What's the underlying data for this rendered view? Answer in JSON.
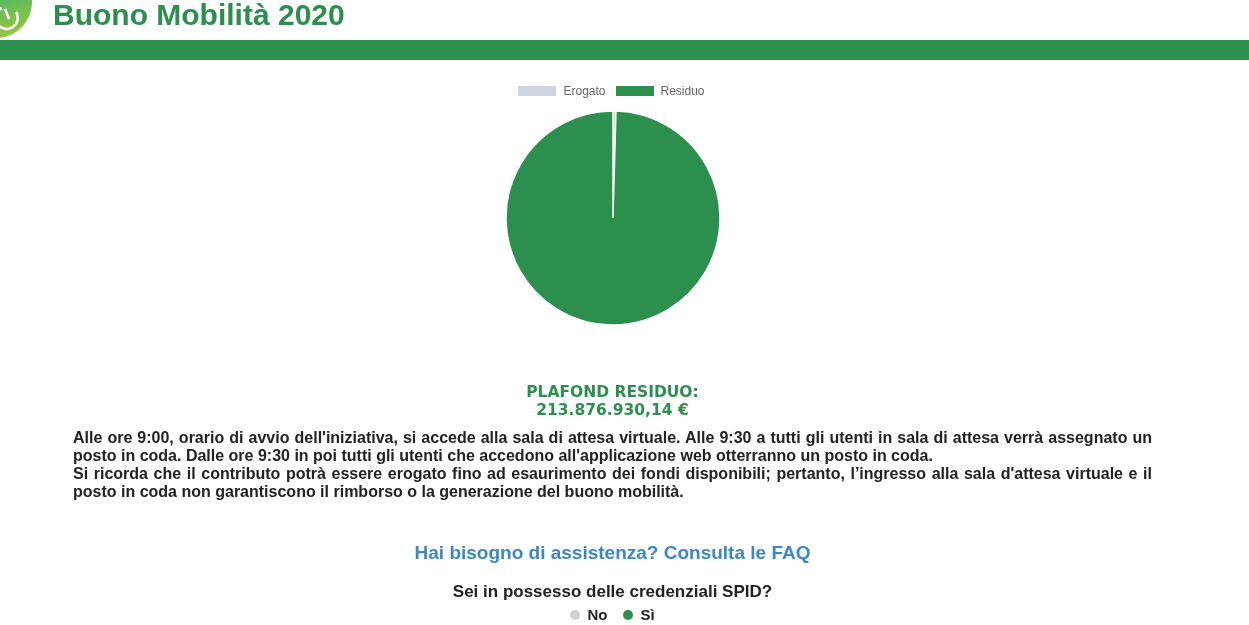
{
  "header": {
    "title": "Buono Mobilità 2020"
  },
  "chart": {
    "legend": [
      {
        "label": "Erogato",
        "color": "#cfd4e0"
      },
      {
        "label": "Residuo",
        "color": "#2d8f4e"
      }
    ]
  },
  "plafond": {
    "label": "PLAFOND RESIDUO:",
    "amount": "213.876.930,14 €"
  },
  "notice": [
    "Alle ore 9:00, orario di avvio dell'iniziativa, si accede alla sala di attesa virtuale. Alle 9:30 a tutti gli utenti in sala di attesa verrà assegnato un posto in coda. Dalle ore 9:30 in poi tutti gli utenti che accedono all'applicazione web otterranno un posto in coda.",
    "Si ricorda che il contributo potrà essere erogato fino ad esaurimento dei fondi disponibili; pertanto, l’ingresso alla sala d'attesa virtuale e il posto in coda non garantiscono il rimborso o la generazione del buono mobilità."
  ],
  "help_link": "Hai bisogno di assistenza? Consulta le FAQ",
  "spid": {
    "question": "Sei in possesso delle credenziali SPID?",
    "options": [
      {
        "label": "No",
        "selected": false
      },
      {
        "label": "Sì",
        "selected": true
      }
    ]
  }
}
